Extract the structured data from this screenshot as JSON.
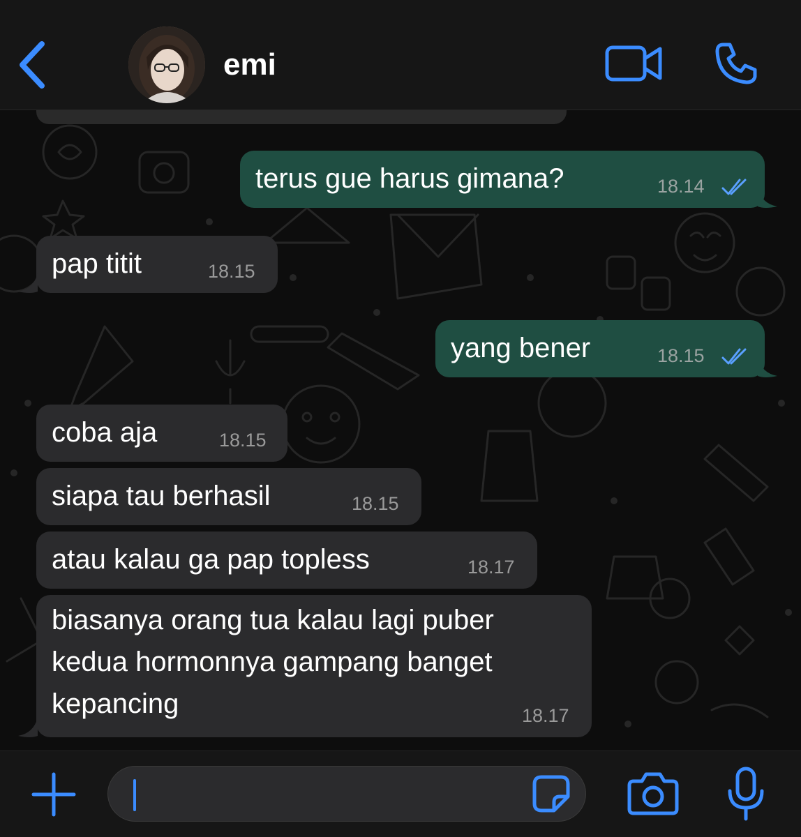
{
  "header": {
    "contact_name": "emi"
  },
  "messages": [
    {
      "direction": "outgoing",
      "text": "terus gue harus gimana?",
      "time": "18.14",
      "status": "read"
    },
    {
      "direction": "incoming",
      "text": "pap titit",
      "time": "18.15"
    },
    {
      "direction": "outgoing",
      "text": "yang bener",
      "time": "18.15",
      "status": "read"
    },
    {
      "direction": "incoming",
      "text": "coba aja",
      "time": "18.15"
    },
    {
      "direction": "incoming",
      "text": "siapa tau berhasil",
      "time": "18.15"
    },
    {
      "direction": "incoming",
      "text": "atau kalau ga pap topless",
      "time": "18.17"
    },
    {
      "direction": "incoming",
      "lines": [
        "biasanya orang tua kalau lagi puber",
        "kedua hormonnya gampang banget",
        "kepancing"
      ],
      "time": "18.17"
    }
  ],
  "input": {
    "placeholder": ""
  },
  "icons": {
    "back": "chevron-left-icon",
    "video": "video-camera-icon",
    "call": "phone-icon",
    "add": "plus-icon",
    "sticker": "sticker-icon",
    "camera": "camera-icon",
    "mic": "microphone-icon"
  },
  "colors": {
    "accent": "#3b8cff",
    "outgoing_bubble": "#1f4e42",
    "incoming_bubble": "#2b2b2d",
    "read_ticks": "#5aa0ff"
  }
}
